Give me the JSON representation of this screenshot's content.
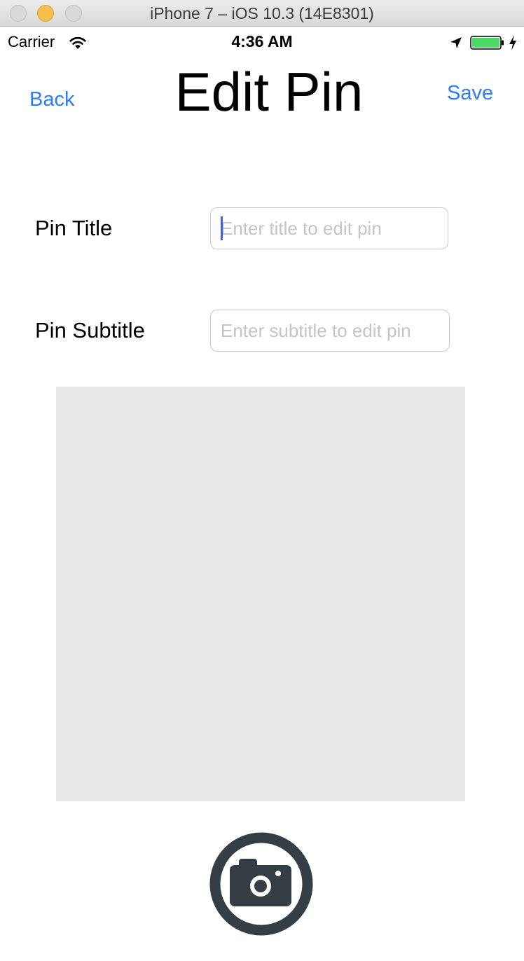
{
  "window": {
    "title": "iPhone 7 – iOS 10.3 (14E8301)"
  },
  "status_bar": {
    "carrier": "Carrier",
    "time": "4:36 AM",
    "battery_color": "#4cd964"
  },
  "nav": {
    "back_label": "Back",
    "title": "Edit Pin",
    "save_label": "Save",
    "tint_color": "#2e7cf6"
  },
  "form": {
    "title_field": {
      "label": "Pin Title",
      "placeholder": "Enter title to edit pin",
      "value": ""
    },
    "subtitle_field": {
      "label": "Pin Subtitle",
      "placeholder": "Enter subtitle to edit pin",
      "value": ""
    }
  },
  "image_area": {
    "background_color": "#e7e7e7"
  },
  "camera_button": {
    "icon": "camera-icon",
    "color": "#363e45"
  }
}
